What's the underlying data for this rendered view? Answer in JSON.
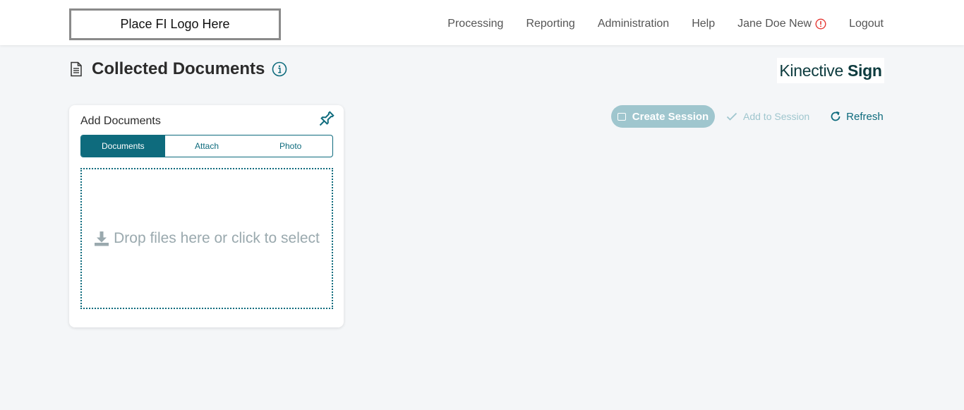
{
  "header": {
    "logo_text": "Place FI Logo Here",
    "nav": {
      "processing": "Processing",
      "reporting": "Reporting",
      "administration": "Administration",
      "help": "Help",
      "user": "Jane Doe New",
      "logout": "Logout"
    }
  },
  "page": {
    "title": "Collected Documents"
  },
  "brand": {
    "part1": "Kinective",
    "part2": "Sign"
  },
  "add_documents": {
    "title": "Add Documents",
    "tabs": [
      "Documents",
      "Attach",
      "Photo"
    ],
    "active_tab": "Documents",
    "dropzone_text": "Drop files here or click to select"
  },
  "actions": {
    "create_session": "Create Session",
    "add_to_session": "Add to Session",
    "refresh": "Refresh"
  },
  "colors": {
    "accent": "#0e6b7d",
    "accent_light": "#9fc6ce",
    "alert": "#e53935",
    "brand_dark": "#0d3b3e"
  },
  "icons": [
    "file-text-icon",
    "info-icon",
    "pin-icon",
    "download-icon",
    "square-icon",
    "check-icon",
    "refresh-icon",
    "alert-circle-icon"
  ]
}
